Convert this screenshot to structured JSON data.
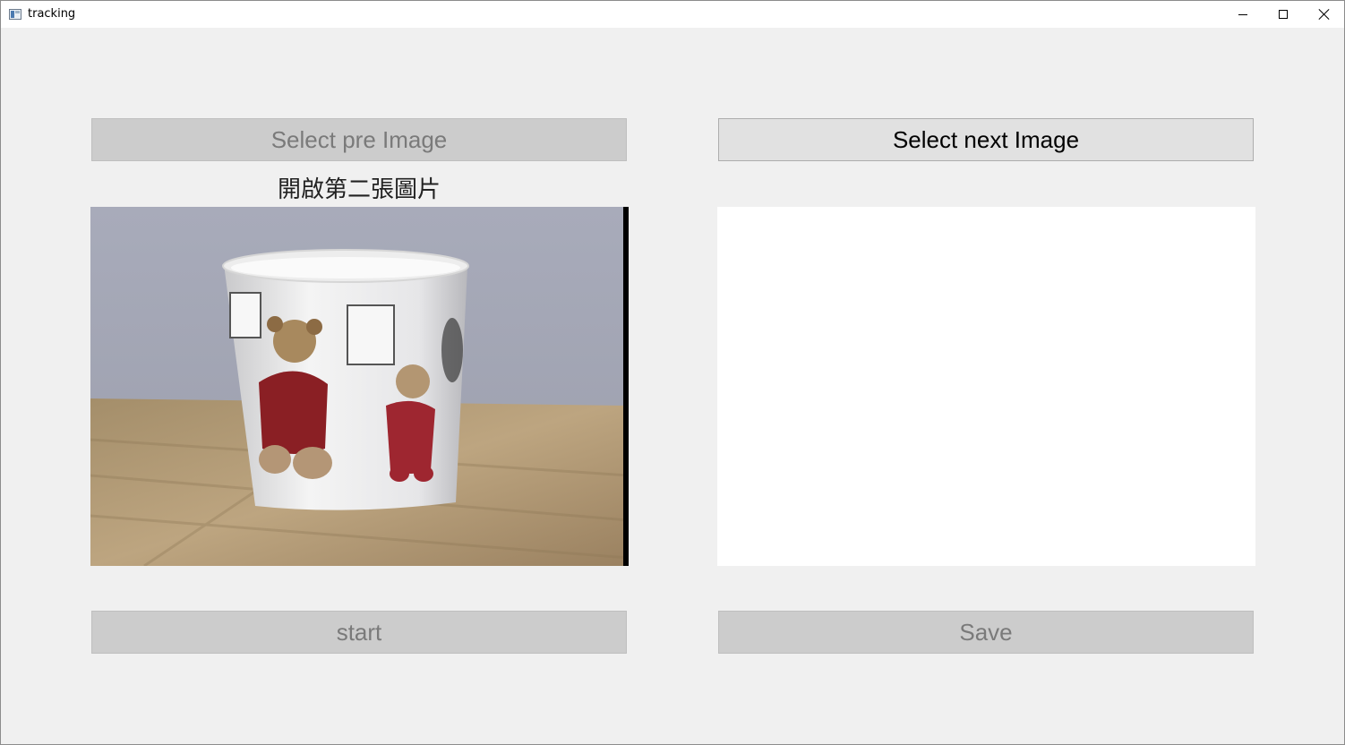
{
  "window": {
    "title": "tracking",
    "controls": [
      "minimize",
      "maximize",
      "close"
    ]
  },
  "buttons": {
    "select_pre": {
      "label": "Select pre Image",
      "enabled": false
    },
    "select_next": {
      "label": "Select next Image",
      "enabled": true
    },
    "start": {
      "label": "start",
      "enabled": false
    },
    "save": {
      "label": "Save",
      "enabled": false
    }
  },
  "left_panel": {
    "caption": "開啟第二張圖片",
    "image_description_icon": "teddy-bear-cup-photo"
  },
  "right_panel": {
    "empty": true
  },
  "colors": {
    "window_bg": "#f0f0f0",
    "button_enabled_bg": "#e1e1e1",
    "button_disabled_bg": "#cccccc",
    "disabled_text": "#7a7a7a",
    "panel_bg": "#ffffff"
  }
}
